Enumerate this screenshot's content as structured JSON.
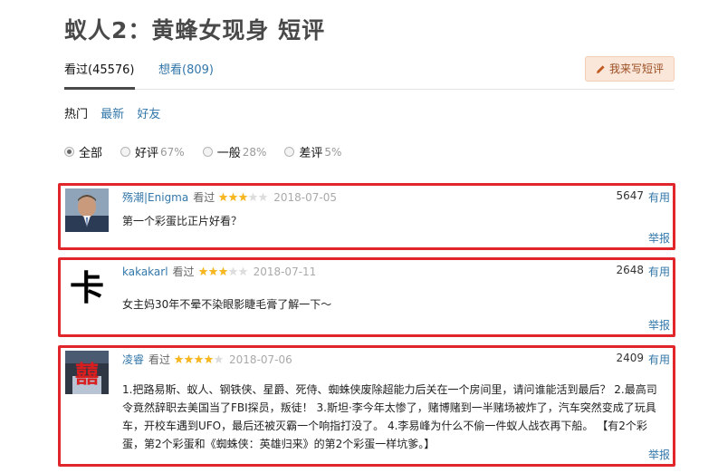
{
  "page": {
    "title": "蚁人2：黄蜂女现身 短评"
  },
  "tabs": {
    "watched": "看过(45576)",
    "want": "想看(809)"
  },
  "write_button": {
    "label": "我来写短评"
  },
  "subnav": {
    "hot": "热门",
    "latest": "最新",
    "friends": "好友"
  },
  "filters": {
    "all": "全部",
    "good": "好评",
    "good_pct": "67%",
    "mid": "一般",
    "mid_pct": "28%",
    "bad": "差评",
    "bad_pct": "5%"
  },
  "comments": [
    {
      "author": "殇潮|Enigma",
      "watched": "看过",
      "rating": 3,
      "date": "2018-07-05",
      "votes": "5647",
      "useful": "有用",
      "content": "第一个彩蛋比正片好看？",
      "report": "举报"
    },
    {
      "author": "kakakarl",
      "watched": "看过",
      "rating": 3,
      "date": "2018-07-11",
      "votes": "2648",
      "useful": "有用",
      "content": "女主妈30年不晕不染眼影睫毛膏了解一下～",
      "avatar_char": "卡",
      "report": "举报"
    },
    {
      "author": "凌睿",
      "watched": "看过",
      "rating": 4,
      "date": "2018-07-06",
      "votes": "2409",
      "useful": "有用",
      "content": "1.把路易斯、蚁人、钢铁侠、星爵、死侍、蜘蛛侠废除超能力后关在一个房间里，请问谁能活到最后？ 2.最高司令竟然辞职去美国当了FBI探员，叛徒！ 3.斯坦·李今年太惨了，赌博赌到一半赌场被炸了，汽车突然变成了玩具车，开校车遇到UFO，最后还被灭霸一个响指打没了。 4.李易峰为什么不偷一件蚁人战衣再下船。 【有2个彩蛋，第2个彩蛋和《蜘蛛侠：英雄归来》的第2个彩蛋一样坑爹。】",
      "avatar_char": "囍",
      "report": "举报"
    }
  ],
  "colors": {
    "link": "#3377aa",
    "highlight_border": "#e0262a",
    "star": "#f7b722",
    "star_empty": "#dddddd"
  }
}
